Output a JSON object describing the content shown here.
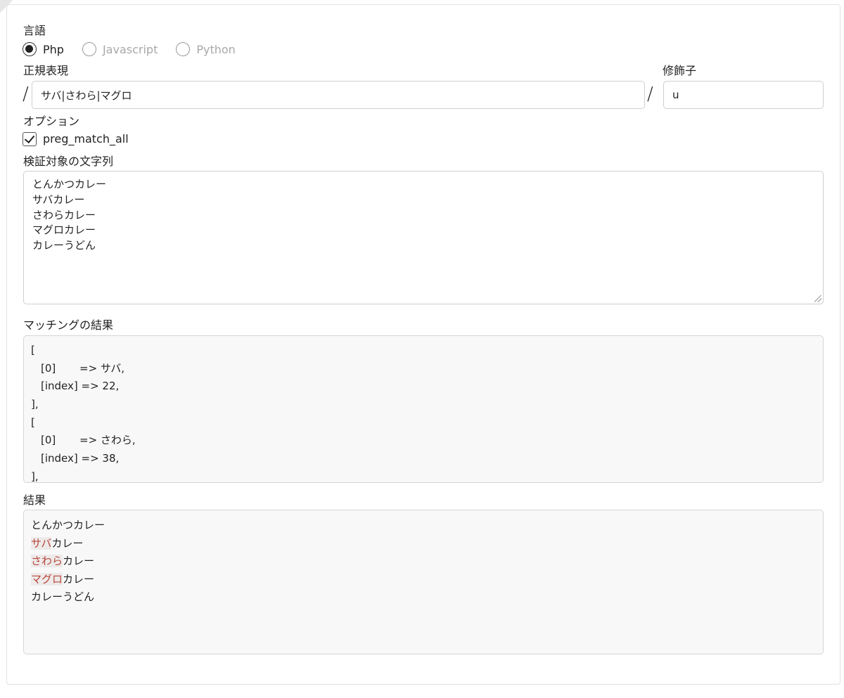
{
  "language": {
    "label": "言語",
    "options": [
      {
        "label": "Php",
        "selected": true
      },
      {
        "label": "Javascript",
        "selected": false
      },
      {
        "label": "Python",
        "selected": false
      }
    ]
  },
  "regex": {
    "label": "正規表現",
    "delimiter": "/",
    "value": "サバ|さわら|マグロ"
  },
  "modifier": {
    "label": "修飾子",
    "value": "u"
  },
  "options": {
    "label": "オプション",
    "preg_match_all": {
      "label": "preg_match_all",
      "checked": true
    }
  },
  "subject": {
    "label": "検証対象の文字列",
    "lines": [
      "とんかつカレー",
      "サバカレー",
      "さわらカレー",
      "マグロカレー",
      "カレーうどん"
    ]
  },
  "matching": {
    "label": "マッチングの結果",
    "matches": [
      {
        "open": "[",
        "key0": "[0]",
        "arrow0": "=> サバ,",
        "key1": "[index]",
        "arrow1": "=> 22,",
        "close": "],"
      },
      {
        "open": "[",
        "key0": "[0]",
        "arrow0": "=> さわら,",
        "key1": "[index]",
        "arrow1": "=> 38,",
        "close": "],"
      }
    ]
  },
  "result": {
    "label": "結果",
    "lines": [
      {
        "match": "",
        "rest": "とんかつカレー"
      },
      {
        "match": "サバ",
        "rest": "カレー"
      },
      {
        "match": "さわら",
        "rest": "カレー"
      },
      {
        "match": "マグロ",
        "rest": "カレー"
      },
      {
        "match": "",
        "rest": "カレーうどん"
      }
    ]
  },
  "colors": {
    "highlight_text": "#b8463a",
    "highlight_bg": "#eeeaea",
    "readonly_bg": "#f8f8f8"
  }
}
